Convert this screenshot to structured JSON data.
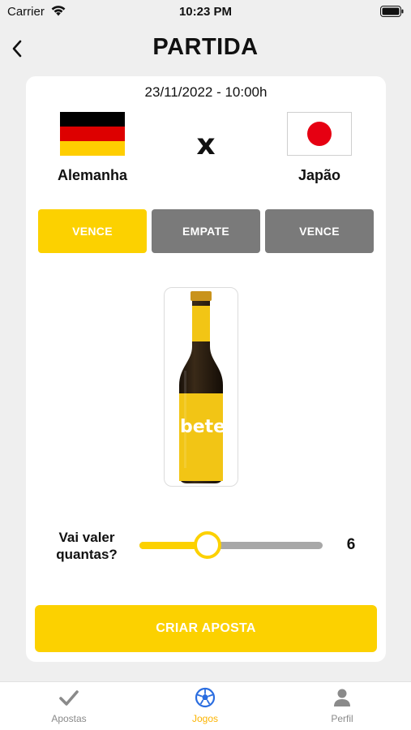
{
  "status_bar": {
    "carrier": "Carrier",
    "time": "10:23 PM"
  },
  "header": {
    "title": "PARTIDA",
    "back_icon": "chevron-left-icon"
  },
  "match": {
    "datetime": "23/11/2022 - 10:00h",
    "versus": "x",
    "home_team": {
      "name": "Alemanha",
      "flag_colors": [
        "#000000",
        "#dd0000",
        "#ffce00"
      ]
    },
    "away_team": {
      "name": "Japão",
      "flag_colors": [
        "#ffffff",
        "#e60012"
      ]
    }
  },
  "choices": [
    {
      "label": "VENCE",
      "selected": true
    },
    {
      "label": "EMPATE",
      "selected": false
    },
    {
      "label": "VENCE",
      "selected": false
    }
  ],
  "product": {
    "label_text": "beter"
  },
  "bet_amount": {
    "label": "Vai valer quantas?",
    "value": "6",
    "min": 1,
    "max": 20,
    "fraction": 0.37
  },
  "cta": {
    "label": "CRIAR APOSTA"
  },
  "tabs": [
    {
      "label": "Apostas",
      "icon": "checkmark-icon",
      "active": false
    },
    {
      "label": "Jogos",
      "icon": "soccer-ball-icon",
      "active": true
    },
    {
      "label": "Perfil",
      "icon": "person-icon",
      "active": false
    }
  ],
  "colors": {
    "accent": "#fcd100",
    "inactive": "#7a7a7a",
    "tab_active": "#fcb400"
  }
}
